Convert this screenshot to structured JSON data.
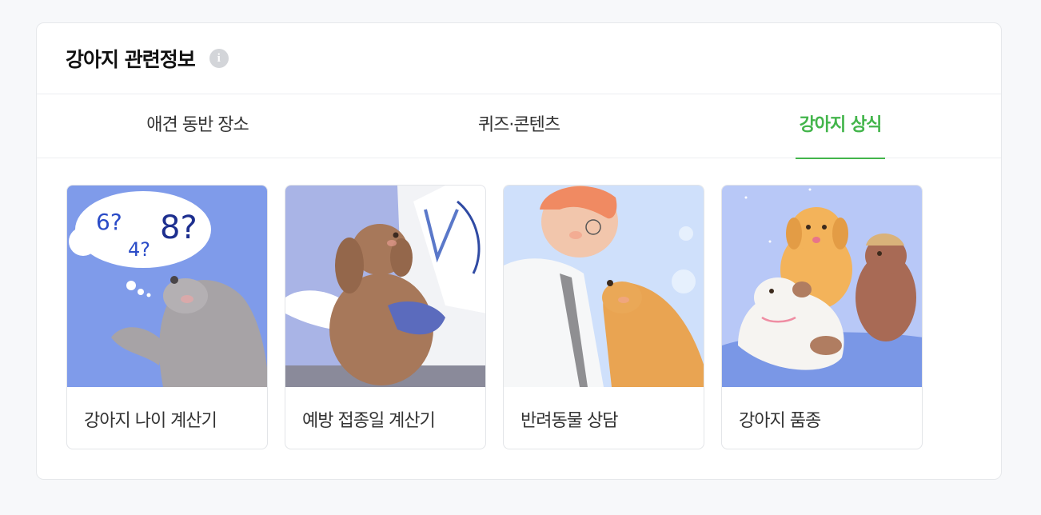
{
  "section": {
    "title": "강아지 관련정보",
    "info_icon": "info-icon"
  },
  "tabs": [
    {
      "label": "애견 동반 장소",
      "active": false
    },
    {
      "label": "퀴즈·콘텐츠",
      "active": false
    },
    {
      "label": "강아지 상식",
      "active": true
    }
  ],
  "colors": {
    "accent": "#43b54b",
    "card_border": "#e3e5e8"
  },
  "cards": [
    {
      "label": "강아지 나이 계산기",
      "bubble": [
        "6?",
        "4?",
        "8?"
      ]
    },
    {
      "label": "예방 접종일 계산기"
    },
    {
      "label": "반려동물 상담"
    },
    {
      "label": "강아지 품종"
    }
  ]
}
